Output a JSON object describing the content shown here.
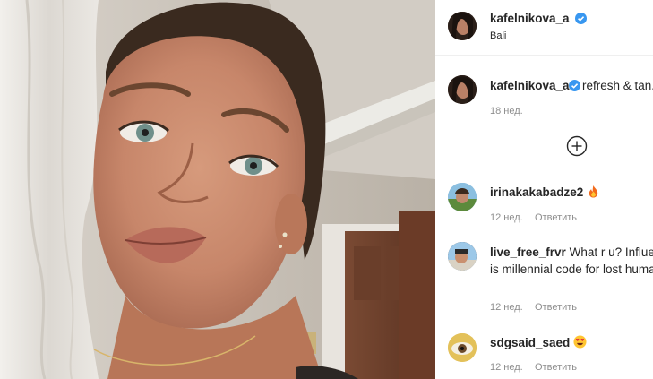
{
  "post": {
    "username": "kafelnikova_a",
    "location": "Bali",
    "caption": "refresh & tan.",
    "caption_time": "18 нед."
  },
  "comments": [
    {
      "username": "irinakakabadze2",
      "text": "",
      "emoji": "fire",
      "time": "12 нед.",
      "reply": "Ответить"
    },
    {
      "username": "live_free_frvr",
      "text": "What r u? Influencer, that is millennial code for lost human being.",
      "time": "12 нед.",
      "reply": "Ответить"
    },
    {
      "username": "sdgsaid_saed",
      "text": "",
      "emoji": "heart-eyes",
      "time": "12 нед.",
      "reply": "Ответить"
    }
  ],
  "icons": {
    "verified": "verified-badge-icon",
    "load_more": "plus-circle-icon"
  },
  "colors": {
    "verified_blue": "#3897f0",
    "muted_text": "#8e8e8e"
  }
}
